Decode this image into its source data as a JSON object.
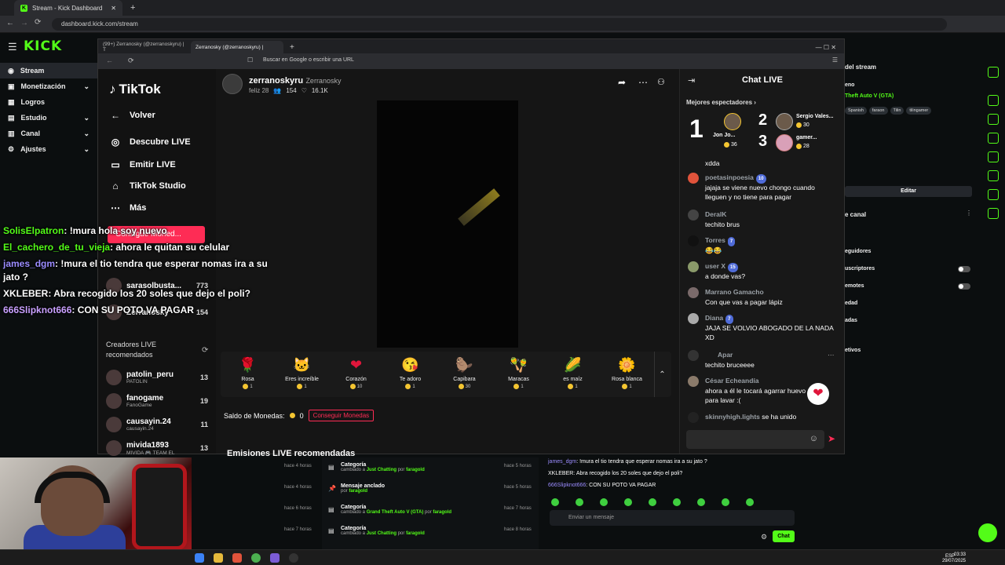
{
  "outer_browser": {
    "tab_title": "Stream - Kick Dashboard",
    "url": "dashboard.kick.com/stream"
  },
  "kick": {
    "logo": "KICK",
    "sidebar": [
      {
        "label": "Stream",
        "icon": "broadcast-icon",
        "active": true,
        "expandable": false
      },
      {
        "label": "Monetización",
        "icon": "money-icon",
        "expandable": true
      },
      {
        "label": "Logros",
        "icon": "trophy-icon",
        "expandable": false
      },
      {
        "label": "Estudio",
        "icon": "studio-icon",
        "expandable": true
      },
      {
        "label": "Canal",
        "icon": "channel-icon",
        "expandable": true
      },
      {
        "label": "Ajustes",
        "icon": "gear-icon",
        "expandable": true
      }
    ],
    "right_panel": {
      "stream_info_title": "del stream",
      "stream_sub": "eno",
      "category": "Theft Auto V (GTA)",
      "tags": [
        "Spanish",
        "faraon",
        "Tilin",
        "tilingamer"
      ],
      "edit_button": "Editar",
      "channel_title": "e canal",
      "rows": [
        "eguidores",
        "uscriptores",
        "emotes",
        "edad",
        "adas",
        "etivos"
      ]
    },
    "history": [
      {
        "title": "Categoría",
        "sub_pre": "cambiado a",
        "value": "Just Chatting",
        "sub_by": "por",
        "user": "faragold",
        "ago": "hace 5 horas"
      },
      {
        "title": "Mensaje anclado",
        "sub_pre": "por",
        "value": "",
        "sub_by": "",
        "user": "faragold",
        "ago": "hace 5 horas"
      },
      {
        "title": "Categoría",
        "sub_pre": "cambiado a",
        "value": "Grand Theft Auto V (GTA)",
        "sub_by": "por",
        "user": "faragold",
        "ago": "hace 7 horas"
      },
      {
        "title": "Categoría",
        "sub_pre": "cambiado a",
        "value": "Just Chatting",
        "sub_by": "por",
        "user": "faragold",
        "ago": "hace 8 horas"
      }
    ],
    "left_agos": [
      "hace 4 horas",
      "hace 4 horas",
      "hace 6 horas",
      "hace 7 horas"
    ],
    "bottom_chat": [
      {
        "user": "james_dgm",
        "text": "!mura el tio tendra que esperar nomas ira a su jato ?"
      },
      {
        "user": "XKLEBER",
        "text": "Abra recogido los 20 soles que dejo el poli?"
      },
      {
        "user": "666Slipknot666",
        "text": "CON SU POTO VA PAGAR"
      }
    ],
    "send_placeholder": "Enviar un mensaje",
    "chat_button": "Chat"
  },
  "overlay_chat": [
    {
      "user": "SolisElpatron",
      "text": "!mura hola soy nuevo",
      "color": "#53fc18"
    },
    {
      "user": "El_cachero_de_tu_vieja",
      "text": "ahora le quitan su celular",
      "color": "#53fc18"
    },
    {
      "user": "james_dgm",
      "text": "!mura el tio tendra que esperar nomas ira a su jato ?",
      "color": "#9b8cff"
    },
    {
      "user": "XKLEBER",
      "text": "Abra recogido los 20 soles que dejo el poli?",
      "color": "#ffffff"
    },
    {
      "user": "666Slipknot666",
      "text": "CON SU POTO VA PAGAR",
      "color": "#c9a0ff"
    }
  ],
  "inner_browser": {
    "tabs": [
      "(99+) Zerranosky (@zerranoskyru) | T",
      "Zerranosky (@zerranoskyru) |"
    ],
    "url_placeholder": "Buscar en Google o escribir una URL"
  },
  "tiktok": {
    "logo": "TikTok",
    "back": "Volver",
    "nav": [
      "Descubre LIVE",
      "Emitir LIVE",
      "TikTok Studio",
      "Más"
    ],
    "promo": "Consigue Moned...",
    "following": {
      "name": "sarasolbusta...",
      "count": "773"
    },
    "following2": {
      "name": "Zerranosky",
      "count": "154"
    },
    "creators_title": "Creadores LIVE recomendados",
    "creators": [
      {
        "name": "patolin_peru",
        "sub": "PATOLIN",
        "count": "13"
      },
      {
        "name": "fanogame",
        "sub": "FanoGame",
        "count": "19"
      },
      {
        "name": "causayin.24",
        "sub": "causayin.24",
        "count": "11"
      },
      {
        "name": "mivida1893",
        "sub": "MIVIDA 🎮 TEAM EL",
        "count": "13"
      }
    ],
    "streamer": {
      "handle": "zerranoskyru",
      "display": "Zerranosky",
      "status": "feliz 28",
      "viewers": "154",
      "likes": "16.1K"
    },
    "gifts": [
      {
        "icon": "🌹",
        "name": "Rosa",
        "price": "1"
      },
      {
        "icon": "🐱",
        "name": "Eres increíble",
        "price": "1"
      },
      {
        "icon": "❤",
        "name": "Corazón",
        "price": "10"
      },
      {
        "icon": "😘",
        "name": "Te adoro",
        "price": "1"
      },
      {
        "icon": "🦫",
        "name": "Capibara",
        "price": "30"
      },
      {
        "icon": "🪇",
        "name": "Maracas",
        "price": "1"
      },
      {
        "icon": "🌽",
        "name": "es maíz",
        "price": "1"
      },
      {
        "icon": "🌼",
        "name": "Rosa blanca",
        "price": "1"
      }
    ],
    "balance_label": "Saldo de Monedas:",
    "balance": "0",
    "get_coins": "Conseguir Monedas",
    "recommended": "Emisiones LIVE recomendadas",
    "chat": {
      "title": "Chat LIVE",
      "best": "Mejores espectadores",
      "top": [
        {
          "rank": "1",
          "name": "Jon Jo...",
          "coins": "36"
        },
        {
          "rank": "2",
          "name": "Sergio Vales...",
          "coins": "30"
        },
        {
          "rank": "3",
          "name": "gamer...",
          "coins": "28"
        }
      ],
      "cut_text": "xdda",
      "messages": [
        {
          "user": "poetasinpoesia",
          "badge": "10",
          "text": "jajaja se viene nuevo chongo cuando lleguen y no tiene para pagar"
        },
        {
          "user": "DeralK",
          "badge": "",
          "text": "techito brus"
        },
        {
          "user": "Torres",
          "badge": "7",
          "text": "😂😂"
        },
        {
          "user": "user X",
          "badge": "15",
          "text": "a donde vas?"
        },
        {
          "user": "Marrano Gamacho",
          "badge": "",
          "text": "Con que vas a pagar lápiz"
        },
        {
          "user": "Diana",
          "badge": "7",
          "text": "JAJA SE VOLVIO ABOGADO DE LA NADA XD"
        },
        {
          "user": "Apar",
          "badge": "",
          "text": "techito bruceeee"
        },
        {
          "user": "César Echeandía",
          "badge": "",
          "text": "ahora a él le tocará agarrar huevo para lavar :("
        }
      ],
      "joined_user": "skinnyhigh.lights",
      "joined_text": "se ha unido"
    }
  },
  "taskbar": {
    "time": "03:33",
    "date": "29/07/2025",
    "lang": "ESP"
  },
  "colors": {
    "kick_green": "#53fc18",
    "tiktok_red": "#fe2c55"
  }
}
